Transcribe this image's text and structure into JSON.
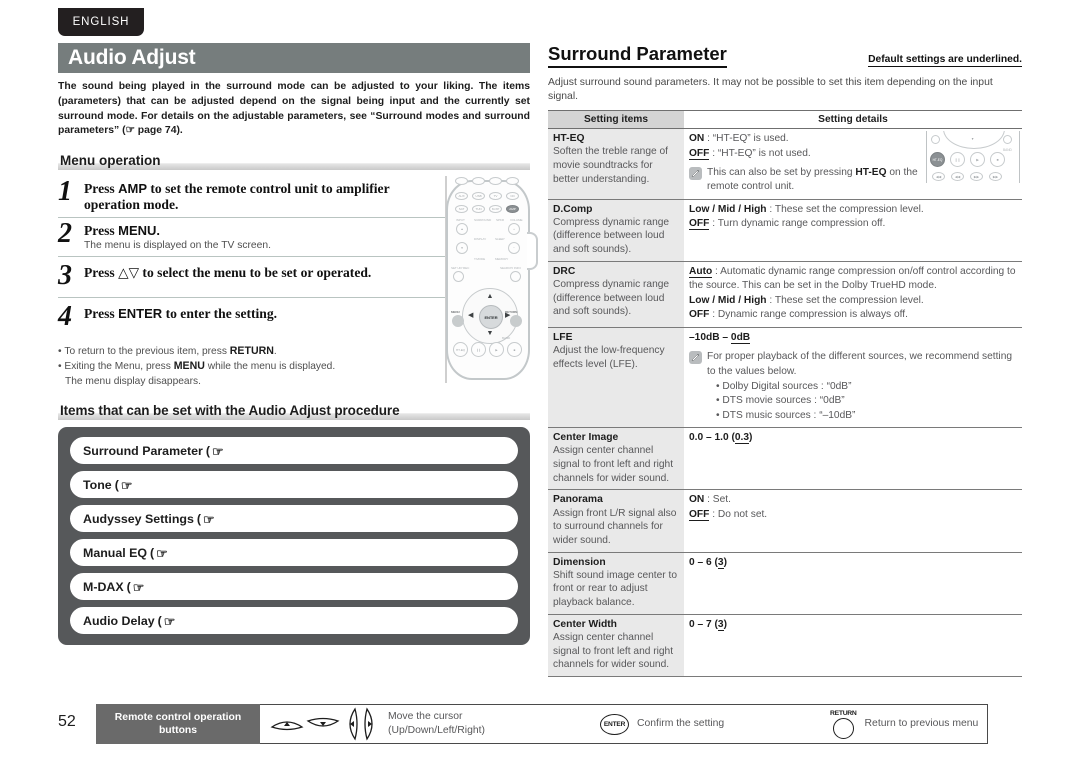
{
  "language_tab": "ENGLISH",
  "left": {
    "title": "Audio Adjust",
    "intro": "The sound being played in the surround mode can be adjusted to your liking. The items (parameters) that can be adjusted depend on the signal being input and the currently set surround mode. For details on the adjustable parameters, see “Surround modes and surround parameters” (☞ page 74).",
    "menu_heading": "Menu operation",
    "steps": [
      {
        "num": "1",
        "main_pre": "Press ",
        "key": "AMP",
        "main_post": " to set the remote control unit to amplifier operation mode.",
        "sub": ""
      },
      {
        "num": "2",
        "main_pre": "Press ",
        "key": "MENU.",
        "main_post": "",
        "sub": "The menu is displayed on the TV screen."
      },
      {
        "num": "3",
        "main_pre": "Press ",
        "key": "△▽",
        "main_post": " to select the menu to be set or operated.",
        "sub": ""
      },
      {
        "num": "4",
        "main_pre": "Press ",
        "key": "ENTER",
        "main_post": " to enter the setting.",
        "sub": ""
      }
    ],
    "notes": [
      {
        "pre": "To return to the previous item, press ",
        "key": "RETURN",
        "post": "."
      },
      {
        "pre": "Exiting the Menu, press ",
        "key": "MENU",
        "post": " while the menu is displayed."
      }
    ],
    "note_extra": "The menu display disappears.",
    "items_heading": "Items that can be set with the Audio Adjust procedure",
    "items": [
      "Surround Parameter",
      "Tone",
      "Audyssey Settings",
      "Manual EQ",
      "M-DAX",
      "Audio Delay"
    ],
    "item_suffix": "(",
    "hand_icon": "pointing-hand-icon"
  },
  "right": {
    "title": "Surround Parameter",
    "default_note": "Default settings are underlined.",
    "intro": "Adjust surround sound parameters. It may not be possible to set this item depending on the input signal.",
    "table": {
      "headers": [
        "Setting items",
        "Setting details"
      ],
      "rows": [
        {
          "name": "HT-EQ",
          "desc": "Soften the treble range of movie soundtracks for better understanding.",
          "details": [
            {
              "bold": "ON",
              "sep": " : ",
              "text": "“HT-EQ” is used."
            },
            {
              "bold": "OFF",
              "underline": true,
              "sep": " : ",
              "text": "“HT-EQ” is not used."
            }
          ],
          "note": {
            "pre": "This can also be set by pressing ",
            "key": "HT-EQ",
            "post": " on the remote control unit."
          },
          "has_remote_image": true
        },
        {
          "name": "D.Comp",
          "desc": "Compress dynamic range (difference between loud and soft sounds).",
          "details": [
            {
              "bold": "Low / Mid / High",
              "sep": " : ",
              "text": "These set the compression level."
            },
            {
              "bold": "OFF",
              "underline": true,
              "sep": " : ",
              "text": "Turn dynamic range compression off."
            }
          ]
        },
        {
          "name": "DRC",
          "desc": "Compress dynamic range (difference between loud and soft sounds).",
          "details": [
            {
              "bold": "Auto",
              "underline": true,
              "sep": " : ",
              "text": "Automatic dynamic range compression on/off control according to the source. This can be set in the Dolby TrueHD mode."
            },
            {
              "bold": "Low / Mid / High",
              "sep": " : ",
              "text": "These set the compression level."
            },
            {
              "bold": "OFF",
              "sep": " : ",
              "text": "Dynamic range compression is always off."
            }
          ]
        },
        {
          "name": "LFE",
          "desc": "Adjust the low-frequency effects level (LFE).",
          "range_pre": "–10dB – ",
          "range_default": "0dB",
          "note_text": "For proper playback of the different sources, we recommend setting to the values below.",
          "bullets": [
            "• Dolby Digital sources : “0dB”",
            "• DTS movie sources : “0dB”",
            "• DTS music sources : “–10dB”"
          ]
        },
        {
          "name": "Center Image",
          "desc": "Assign center channel signal to front left and right channels for wider sound.",
          "range_pre": "0.0 – 1.0 (",
          "range_default": "0.3",
          "range_post": ")"
        },
        {
          "name": "Panorama",
          "desc": "Assign front L/R signal also to surround channels for wider sound.",
          "details": [
            {
              "bold": "ON",
              "sep": " : ",
              "text": "Set."
            },
            {
              "bold": "OFF",
              "underline": true,
              "sep": " : ",
              "text": "Do not set."
            }
          ]
        },
        {
          "name": "Dimension",
          "desc": "Shift sound image center to front or rear to adjust playback balance.",
          "range_pre": "0 – 6 (",
          "range_default": "3",
          "range_post": ")"
        },
        {
          "name": "Center Width",
          "desc": "Assign center channel signal to front left and right channels for wider sound.",
          "range_pre": "0 – 7 (",
          "range_default": "3",
          "range_post": ")"
        }
      ]
    }
  },
  "footer": {
    "page_number": "52",
    "label": "Remote control operation buttons",
    "label_line1": "Remote control operation",
    "label_line2": "buttons",
    "cursor_text_line1": "Move the cursor",
    "cursor_text_line2": "(Up/Down/Left/Right)",
    "enter_label": "ENTER",
    "enter_text": "Confirm the setting",
    "return_label": "RETURN",
    "return_text": "Return to previous menu"
  },
  "colors": {
    "title_bar": "#767d7d",
    "items_panel": "#56585a",
    "table_header": "#d4d4d4",
    "table_cell_left": "#e9e9e9",
    "footer_gray": "#6a6a6a",
    "tab_dark": "#231f20"
  }
}
